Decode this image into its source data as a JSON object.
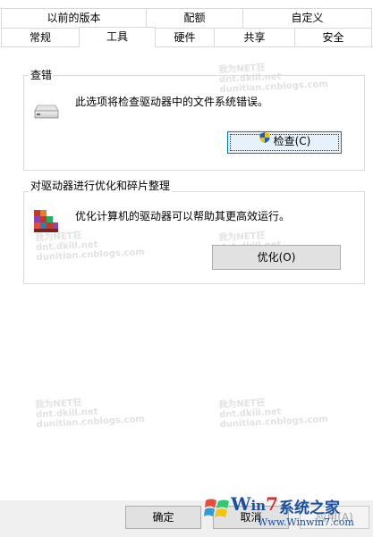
{
  "tabs": {
    "row1": [
      "以前的版本",
      "配额",
      "自定义"
    ],
    "row2": [
      "常规",
      "工具",
      "硬件",
      "共享",
      "安全"
    ],
    "active": "工具"
  },
  "check_group": {
    "title": "查错",
    "description": "此选项将检查驱动器中的文件系统错误。",
    "button_label": "检查(C)",
    "icon": "drive-icon",
    "button_icon": "uac-shield-icon"
  },
  "optimize_group": {
    "title": "对驱动器进行优化和碎片整理",
    "description": "优化计算机的驱动器可以帮助其更高效运行。",
    "button_label": "优化(O)",
    "icon": "defrag-icon"
  },
  "footer": {
    "ok_label": "确定",
    "cancel_label": "取消",
    "apply_label": "应用(A)"
  },
  "watermark": {
    "line1": "我为NET狂",
    "line2": "dnt.dkill.net",
    "line3": "dunitian.cnblogs.com"
  },
  "logo": {
    "brand_w": "W",
    "brand_in": "in",
    "brand_7": "7",
    "brand_cn": "系统之家",
    "url": "Www.Winwin7.com"
  },
  "colors": {
    "accent": "#0078d7",
    "shield_blue": "#1d5fbf",
    "shield_yellow": "#f5c400"
  }
}
